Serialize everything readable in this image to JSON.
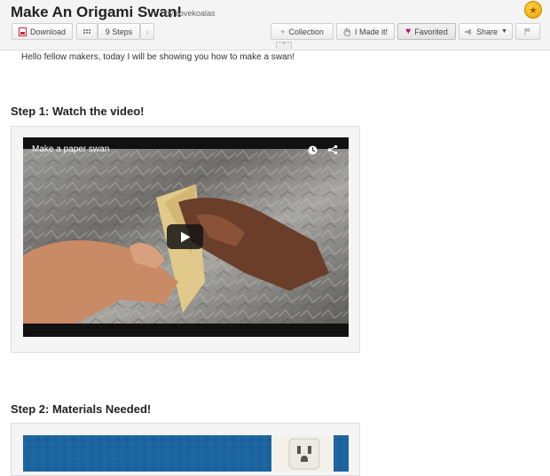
{
  "header": {
    "title": "Make An Origami Swan!",
    "by_prefix": "by",
    "author": "ilovekoalas"
  },
  "toolbar": {
    "download_label": "Download",
    "steps_label": "9 Steps",
    "collection_label": "Collection",
    "collection_prefix": "+",
    "made_it_label": "I Made it!",
    "favorited_label": "Favorited",
    "share_label": "Share",
    "icons": [
      "pdf-icon",
      "grid-icon",
      "chevron-right-icon",
      "hand-icon",
      "heart-icon",
      "megaphone-icon",
      "caret-down-icon",
      "flag-icon",
      "chevron-up-icon",
      "star-badge-icon"
    ]
  },
  "intro": "Hello fellow makers, today I will be showing you how to make a swan!",
  "steps": [
    {
      "title": "Step 1: Watch the video!",
      "video_title": "Make a paper swan"
    },
    {
      "title": "Step 2: Materials Needed!"
    }
  ],
  "colors": {
    "favorited_heart": "#b0165a",
    "badge": "#f2b51c",
    "video_background": "#111111"
  }
}
